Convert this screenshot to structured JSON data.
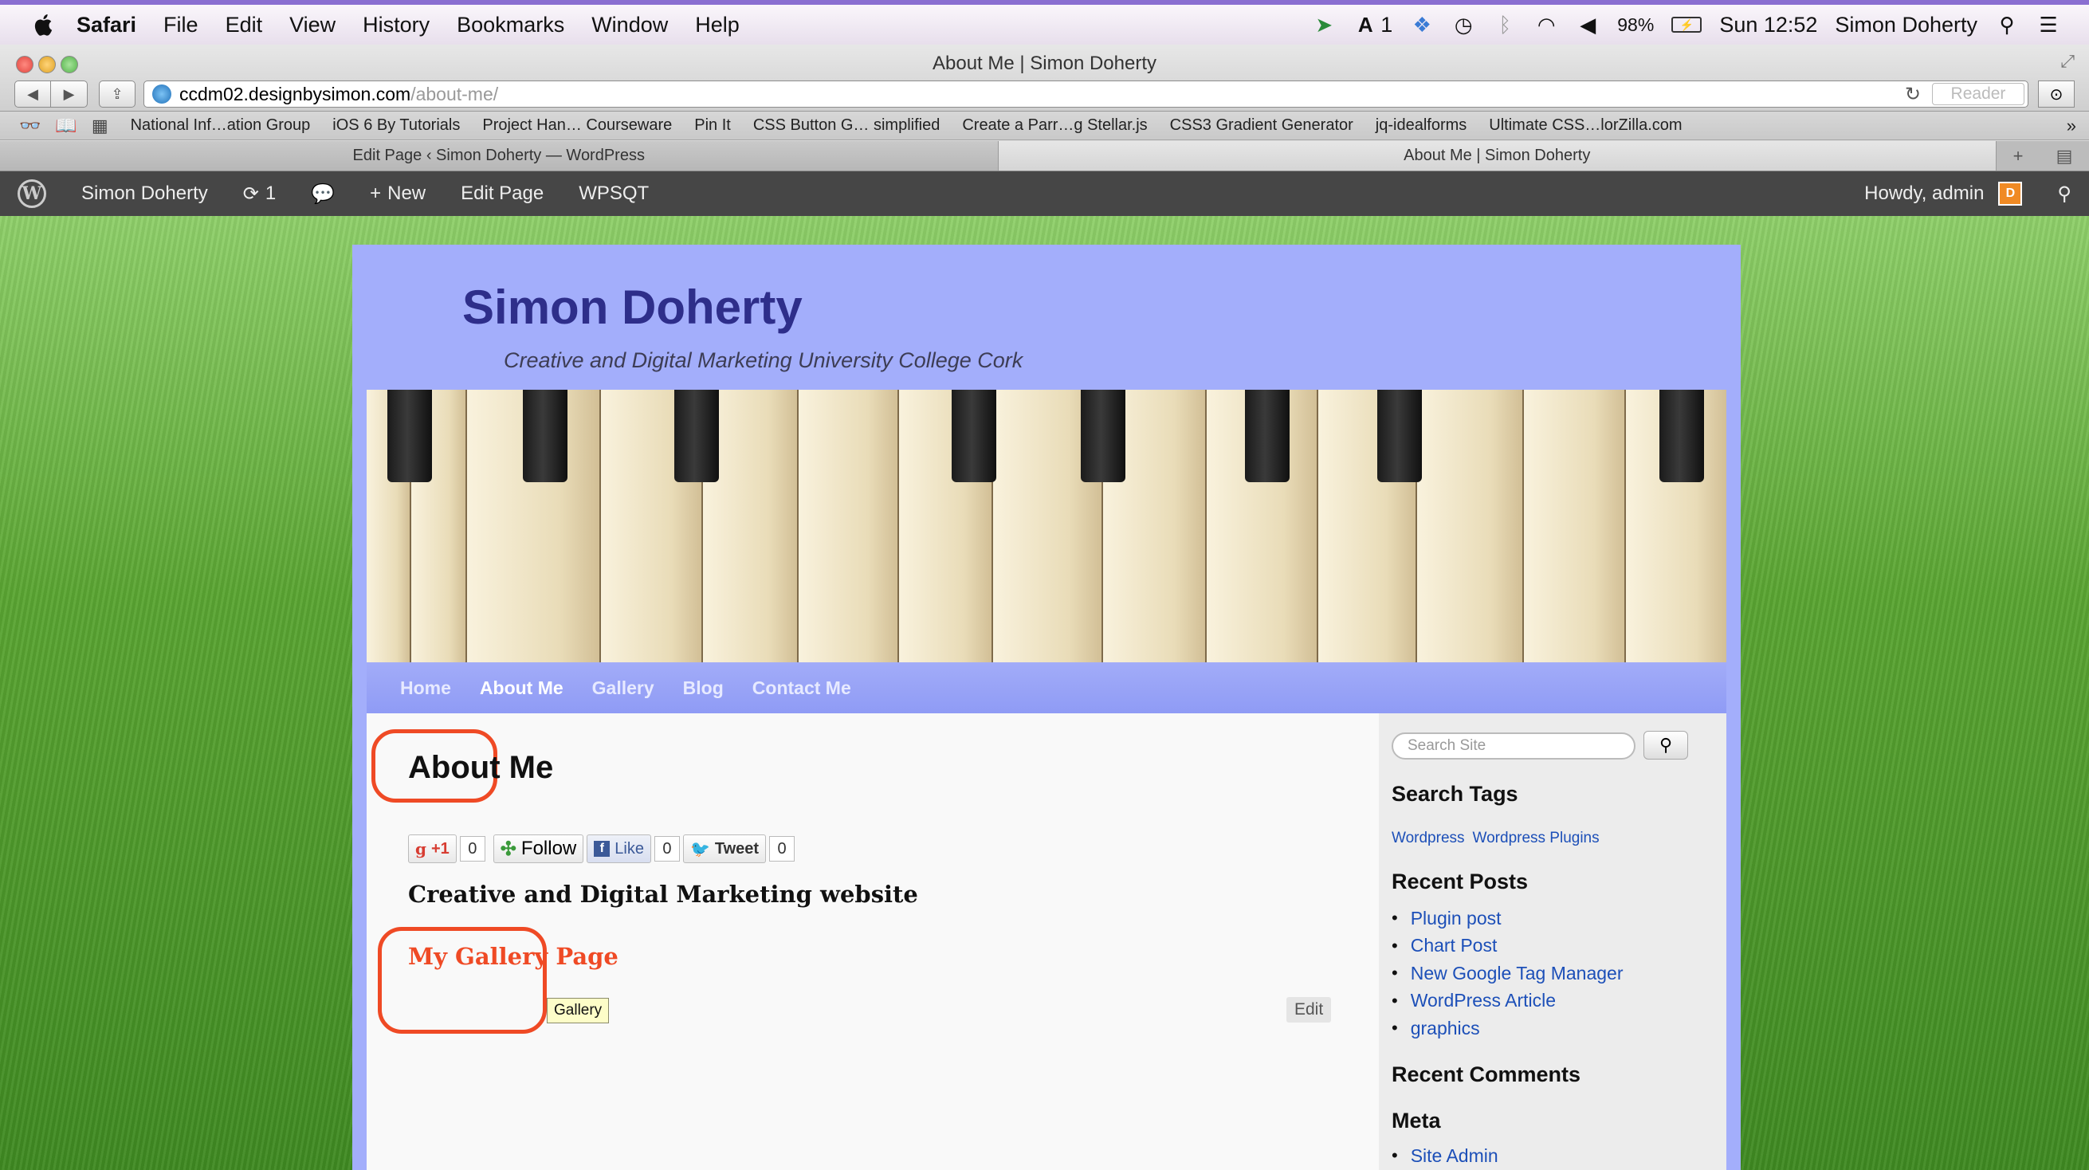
{
  "menubar": {
    "app": "Safari",
    "items": [
      "File",
      "Edit",
      "View",
      "History",
      "Bookmarks",
      "Window",
      "Help"
    ],
    "status_count": "1",
    "battery": "98%",
    "clock": "Sun 12:52",
    "user": "Simon Doherty"
  },
  "window": {
    "title": "About Me | Simon Doherty",
    "address_domain": "ccdm02.designbysimon.com",
    "address_path": "/about-me/",
    "reader_label": "Reader"
  },
  "bookmarks": [
    "National Inf…ation Group",
    "iOS 6 By Tutorials",
    "Project Han… Courseware",
    "Pin It",
    "CSS Button G… simplified",
    "Create a Parr…g Stellar.js",
    "CSS3 Gradient Generator",
    "jq-idealforms",
    "Ultimate CSS…lorZilla.com"
  ],
  "tabs": [
    {
      "label": "Edit Page ‹ Simon Doherty — WordPress"
    },
    {
      "label": "About Me | Simon Doherty"
    }
  ],
  "wp_admin_bar": {
    "site_name": "Simon Doherty",
    "updates_count": "1",
    "new_label": "New",
    "edit_page_label": "Edit Page",
    "plugin_label": "WPSQT",
    "howdy": "Howdy, admin"
  },
  "site": {
    "title": "Simon Doherty",
    "tagline": "Creative and Digital Marketing University College Cork",
    "nav": [
      {
        "label": "Home"
      },
      {
        "label": "About Me"
      },
      {
        "label": "Gallery"
      },
      {
        "label": "Blog"
      },
      {
        "label": "Contact Me"
      }
    ]
  },
  "content": {
    "heading": "About Me",
    "social": {
      "gplus_label": "+1",
      "gplus_count": "0",
      "follow_label": "Follow",
      "like_label": "Like",
      "like_count": "0",
      "tweet_label": "Tweet",
      "tweet_count": "0"
    },
    "subtitle": "Creative and Digital Marketing website",
    "gallery_link": "My Gallery Page",
    "tooltip": "Gallery",
    "edit_label": "Edit"
  },
  "sidebar": {
    "search_placeholder": "Search Site",
    "tags_title": "Search Tags",
    "tags": [
      "Wordpress",
      "Wordpress Plugins"
    ],
    "recent_posts_title": "Recent Posts",
    "recent_posts": [
      "Plugin post",
      "Chart Post",
      "New Google Tag Manager",
      "WordPress Article",
      "graphics"
    ],
    "recent_comments_title": "Recent Comments",
    "meta_title": "Meta",
    "meta_links": [
      "Site Admin"
    ]
  },
  "colors": {
    "site_bg": "#a3aefb",
    "title_color": "#2e2e8a",
    "annotation_red": "#ef4a25",
    "link_blue": "#1c4fb8",
    "wp_bar": "#464646"
  }
}
